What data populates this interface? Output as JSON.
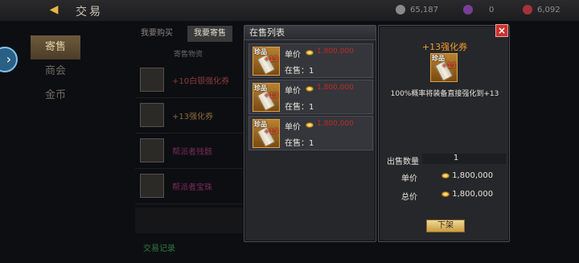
{
  "header": {
    "title": "交易",
    "currencies": [
      {
        "icon": "silver-coin-icon",
        "value": "65,187",
        "color": "#8a8a8a"
      },
      {
        "icon": "purple-gem-icon",
        "value": "0",
        "color": "#7a3e98"
      },
      {
        "icon": "red-ticket-icon",
        "value": "6,092",
        "color": "#a8323a"
      }
    ]
  },
  "side_menu": [
    {
      "label": "寄售",
      "active": true
    },
    {
      "label": "商会",
      "active": false
    },
    {
      "label": "金币",
      "active": false
    }
  ],
  "tabs": [
    {
      "label": "我要购买",
      "active": false
    },
    {
      "label": "我要寄售",
      "active": true
    }
  ],
  "bg_list": {
    "header": "寄售物资",
    "rows": [
      {
        "label": "+10白银强化券",
        "color": "#8a3a3a"
      },
      {
        "label": "+13强化券",
        "color": "#8a6a3a"
      },
      {
        "label": "帮派者残骸",
        "color": "#7a2a5a"
      },
      {
        "label": "帮派者宝珠",
        "color": "#7a2a5a"
      }
    ],
    "footer": "交易记录"
  },
  "list_panel": {
    "title": "在售列表",
    "listings": [
      {
        "tag": "珍品",
        "enhance": "+13",
        "price_label": "单价",
        "price": "1,800,000",
        "stock_label": "在售",
        "stock": "1"
      },
      {
        "tag": "珍品",
        "enhance": "+13",
        "price_label": "单价",
        "price": "1,800,000",
        "stock_label": "在售",
        "stock": "1"
      },
      {
        "tag": "珍品",
        "enhance": "+13",
        "price_label": "单价",
        "price": "1,800,000",
        "stock_label": "在售",
        "stock": "1"
      }
    ]
  },
  "detail_panel": {
    "item_name": "+13强化券",
    "tag": "珍品",
    "enhance": "+13",
    "description": "100%概率将装备直接强化到+13",
    "quantity_label": "出售数量",
    "quantity": "1",
    "unit_price_label": "单价",
    "unit_price": "1,800,000",
    "total_label": "总价",
    "total": "1,800,000",
    "delist_button": "下架",
    "close": "×"
  },
  "colors": {
    "price_red": "#c32a23",
    "item_name_orange": "#f09b2e",
    "button_gold": "#c79d41"
  }
}
